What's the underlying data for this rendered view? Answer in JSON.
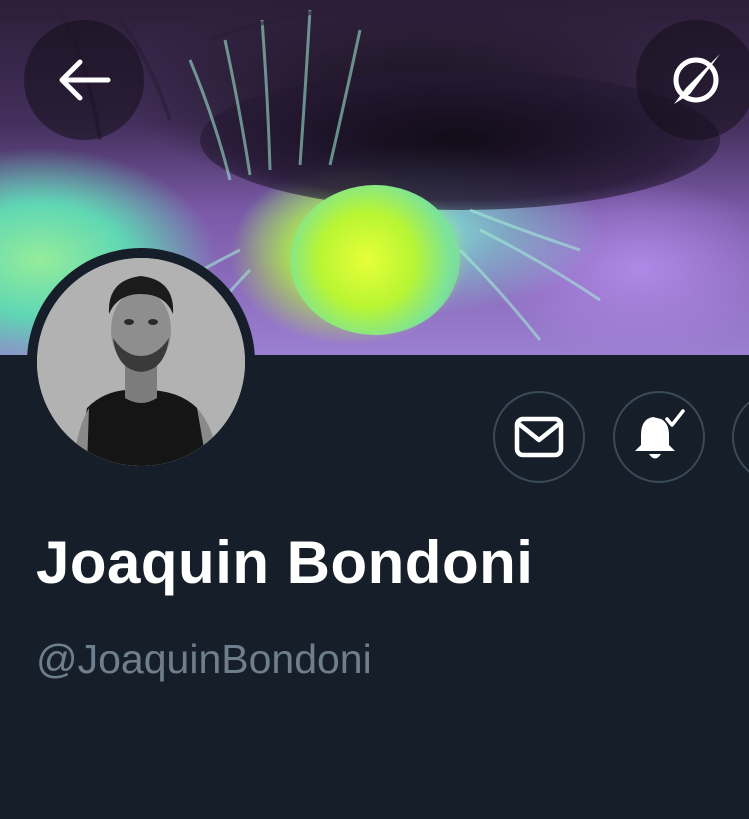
{
  "profile": {
    "display_name": "Joaquin Bondoni",
    "handle": "@JoaquinBondoni"
  },
  "icons": {
    "back": "back-arrow-icon",
    "discover": "compass-icon",
    "message": "envelope-icon",
    "notifications": "bell-check-icon"
  },
  "colors": {
    "background": "#161f29",
    "name": "#ffffff",
    "handle": "#6e7e8c",
    "button_border": "#3b4a57"
  }
}
